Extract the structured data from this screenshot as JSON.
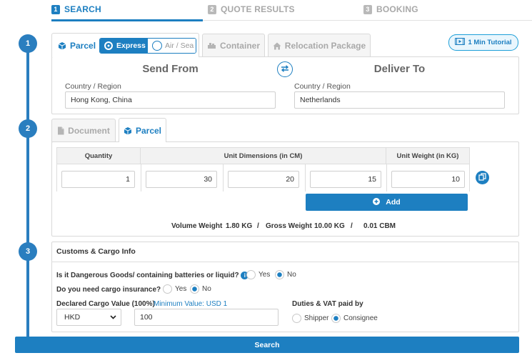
{
  "steps": [
    {
      "num": "1",
      "label": "SEARCH"
    },
    {
      "num": "2",
      "label": "QUOTE RESULTS"
    },
    {
      "num": "3",
      "label": "BOOKING"
    }
  ],
  "timeline": [
    "1",
    "2",
    "3"
  ],
  "shipment_tabs": {
    "parcel": "Parcel",
    "container": "Container",
    "relocation": "Relocation Package"
  },
  "modes": {
    "express": "Express",
    "air_sea": "Air / Sea"
  },
  "tutorial_label": "1 Min Tutorial",
  "route": {
    "from_title": "Send From",
    "to_title": "Deliver To",
    "from_label": "Country / Region",
    "from_value": "Hong Kong, China",
    "to_label": "Country / Region",
    "to_value": "Netherlands"
  },
  "package_tabs": {
    "document": "Document",
    "parcel": "Parcel"
  },
  "dimensions": {
    "headers": {
      "quantity": "Quantity",
      "dims": "Unit Dimensions (in CM)",
      "weight": "Unit Weight (in KG)"
    },
    "row": {
      "quantity": "1",
      "length": "30",
      "width": "20",
      "height": "15",
      "weight": "10"
    },
    "add_label": "Add"
  },
  "summary": {
    "volume_label": "Volume Weight",
    "volume_value": "1.80 KG",
    "sep": "/",
    "gross_label": "Gross Weight",
    "gross_value": "10.00 KG",
    "cbm": "0.01 CBM"
  },
  "customs": {
    "title": "Customs & Cargo Info",
    "dg_question": "Is it Dangerous Goods/ containing batteries or liquid?",
    "insurance_question": "Do you need cargo insurance?",
    "yes": "Yes",
    "no": "No",
    "declared_label": "Declared Cargo Value (100%)",
    "minimum": "Minimum Value: USD 1",
    "currency": "HKD",
    "value": "100",
    "duties_label": "Duties & VAT paid by",
    "shipper": "Shipper",
    "consignee": "Consignee"
  },
  "search_label": "Search",
  "colors": {
    "accent": "#1d7fc1",
    "timeline": "#2a7ebf"
  }
}
